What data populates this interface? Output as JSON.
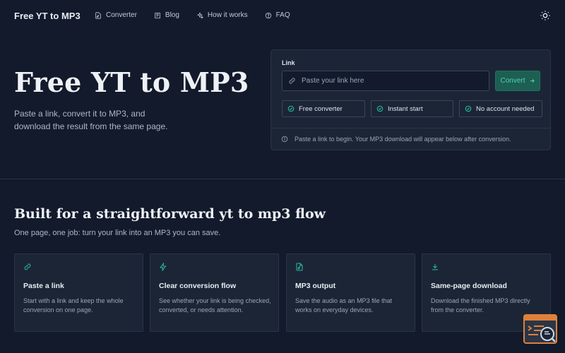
{
  "nav": {
    "brand": "Free YT to MP3",
    "links": [
      {
        "label": "Converter",
        "icon": "file-music-icon"
      },
      {
        "label": "Blog",
        "icon": "book-icon"
      },
      {
        "label": "How it works",
        "icon": "sparkles-icon"
      },
      {
        "label": "FAQ",
        "icon": "help-circle-icon"
      }
    ],
    "theme_icon": "sun-icon"
  },
  "hero": {
    "title": "Free YT to MP3",
    "subtitle": "Paste a link, convert it to MP3, and download the result from the same page."
  },
  "converter": {
    "label": "Link",
    "input_placeholder": "Paste your link here",
    "input_value": "",
    "convert_label": "Convert",
    "chips": [
      "Free converter",
      "Instant start",
      "No account needed"
    ],
    "note": "Paste a link to begin. Your MP3 download will appear below after conversion."
  },
  "features_section": {
    "title": "Built for a straightforward yt to mp3 flow",
    "subtitle": "One page, one job: turn your link into an MP3 you can save.",
    "items": [
      {
        "title": "Paste a link",
        "desc": "Start with a link and keep the whole conversion on one page.",
        "icon": "link-icon"
      },
      {
        "title": "Clear conversion flow",
        "desc": "See whether your link is being checked, converted, or needs attention.",
        "icon": "zap-icon"
      },
      {
        "title": "MP3 output",
        "desc": "Save the audio as an MP3 file that works on everyday devices.",
        "icon": "file-audio-icon"
      },
      {
        "title": "Same-page download",
        "desc": "Download the finished MP3 directly from the converter.",
        "icon": "download-icon"
      }
    ]
  },
  "colors": {
    "background": "#121a2b",
    "card": "#1b2536",
    "accent": "#2bbd98",
    "border": "#2a3547"
  }
}
